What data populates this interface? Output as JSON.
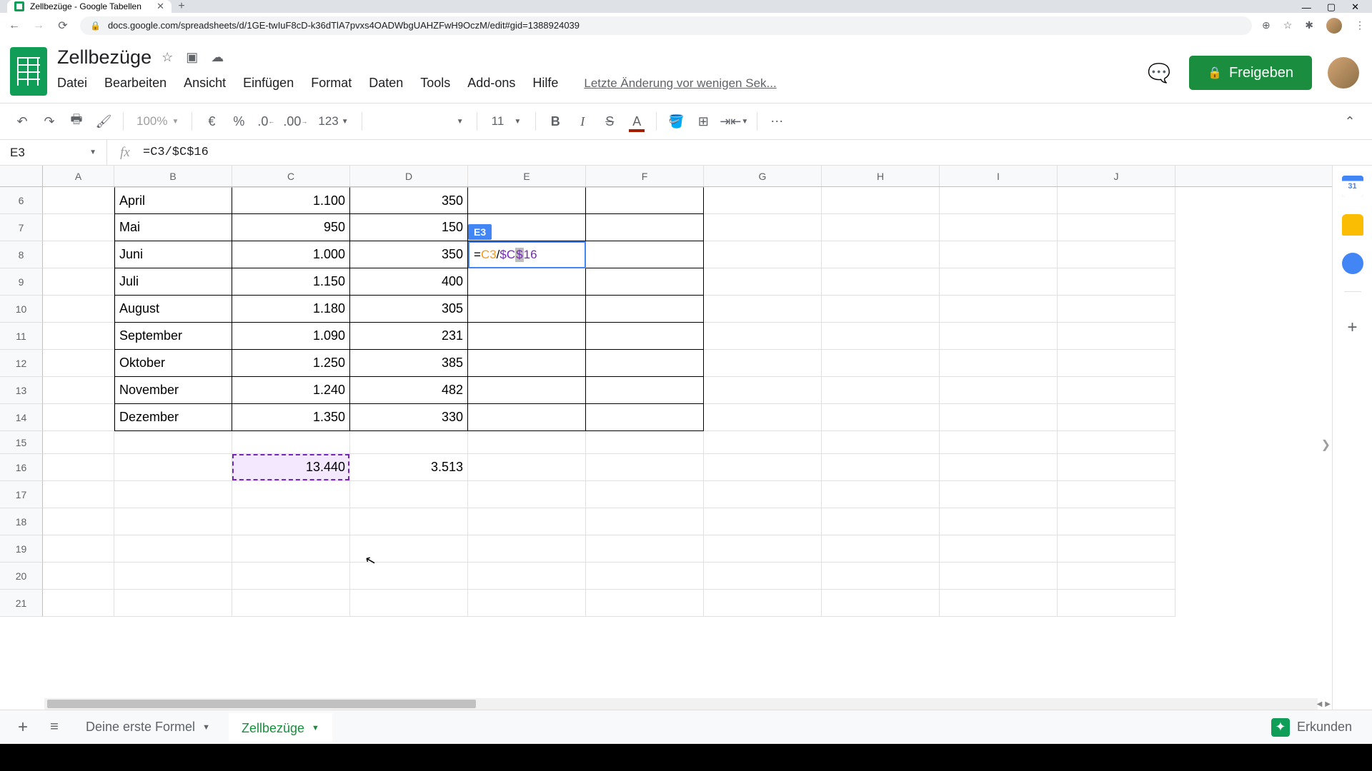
{
  "browser": {
    "tab_title": "Zellbezüge - Google Tabellen",
    "url": "docs.google.com/spreadsheets/d/1GE-twIuF8cD-k36dTlA7pvxs4OADWbgUAHZFwH9OczM/edit#gid=1388924039"
  },
  "header": {
    "doc_title": "Zellbezüge",
    "menu": [
      "Datei",
      "Bearbeiten",
      "Ansicht",
      "Einfügen",
      "Format",
      "Daten",
      "Tools",
      "Add-ons",
      "Hilfe"
    ],
    "history": "Letzte Änderung vor wenigen Sek...",
    "share_label": "Freigeben"
  },
  "toolbar": {
    "zoom": "100%",
    "currency": "€",
    "percent": "%",
    "dec_less": ".0",
    "dec_more": ".00",
    "num_format": "123",
    "font_size": "11"
  },
  "formula_bar": {
    "cell_ref": "E3",
    "formula": "=C3/$C$16"
  },
  "columns": [
    "A",
    "B",
    "C",
    "D",
    "E",
    "F",
    "G",
    "H",
    "I",
    "J"
  ],
  "rows": [
    {
      "n": 6,
      "B": "April",
      "C": "1.100",
      "D": "350"
    },
    {
      "n": 7,
      "B": "Mai",
      "C": "950",
      "D": "150"
    },
    {
      "n": 8,
      "B": "Juni",
      "C": "1.000",
      "D": "350",
      "E_edit": {
        "label": "E3",
        "parts": [
          {
            "t": "=",
            "c": ""
          },
          {
            "t": "C3",
            "c": "r1"
          },
          {
            "t": "/",
            "c": ""
          },
          {
            "t": "$C",
            "c": "r2"
          },
          {
            "t": "$",
            "c": "r2 sel"
          },
          {
            "t": "16",
            "c": "r2"
          }
        ]
      }
    },
    {
      "n": 9,
      "B": "Juli",
      "C": "1.150",
      "D": "400"
    },
    {
      "n": 10,
      "B": "August",
      "C": "1.180",
      "D": "305"
    },
    {
      "n": 11,
      "B": "September",
      "C": "1.090",
      "D": "231"
    },
    {
      "n": 12,
      "B": "Oktober",
      "C": "1.250",
      "D": "385"
    },
    {
      "n": 13,
      "B": "November",
      "C": "1.240",
      "D": "482"
    },
    {
      "n": 14,
      "B": "Dezember",
      "C": "1.350",
      "D": "330"
    },
    {
      "n": 15
    },
    {
      "n": 16,
      "C": "13.440",
      "C_march": true,
      "D": "3.513"
    },
    {
      "n": 17
    },
    {
      "n": 18
    },
    {
      "n": 19
    },
    {
      "n": 20
    },
    {
      "n": 21
    }
  ],
  "sheets": {
    "tab1": "Deine erste Formel",
    "tab2": "Zellbezüge",
    "explore": "Erkunden"
  }
}
